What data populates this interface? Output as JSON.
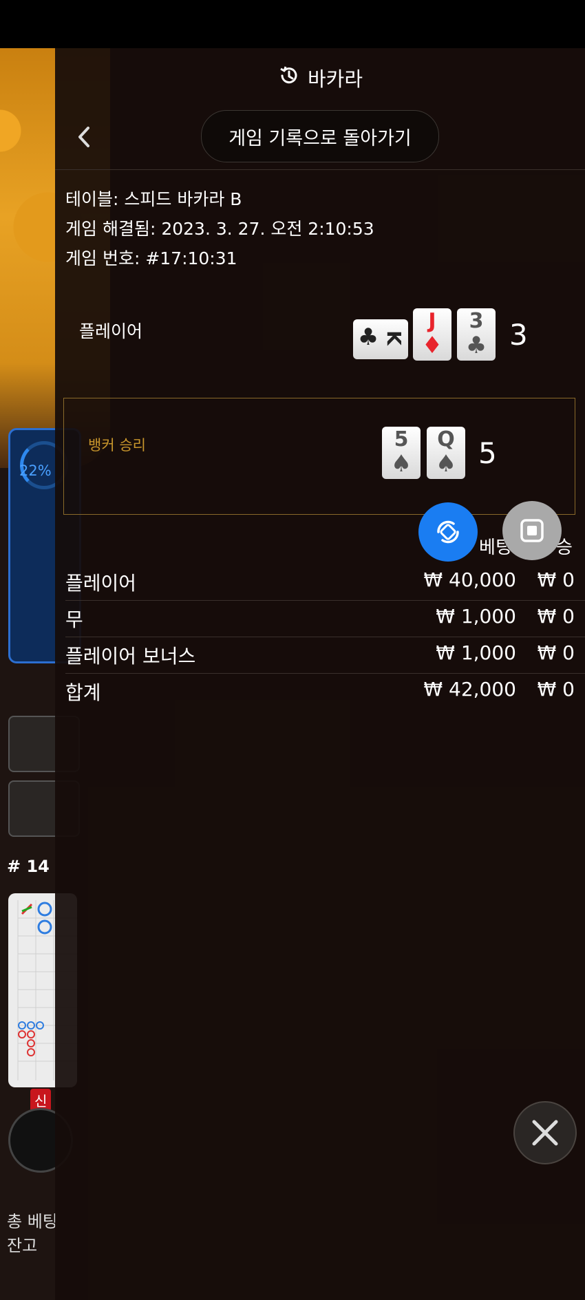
{
  "overlay": {
    "title": "바카라",
    "back_button_label": "게임 기록으로 돌아가기",
    "info": {
      "table": "테이블: 스피드 바카라 B",
      "resolved": "게임 해결됨: 2023. 3. 27. 오전 2:10:53",
      "game_number": "게임 번호: #17:10:31"
    },
    "player": {
      "label": "플레이어",
      "cards": [
        {
          "rank": "K",
          "suit": "♣",
          "color": "black",
          "sideways": true
        },
        {
          "rank": "J",
          "suit": "♦",
          "color": "red"
        },
        {
          "rank": "3",
          "suit": "♣",
          "color": "black"
        }
      ],
      "score": "3"
    },
    "banker": {
      "label": "뱅커 승리",
      "cards": [
        {
          "rank": "5",
          "suit": "♠",
          "color": "black"
        },
        {
          "rank": "Q",
          "suit": "♠",
          "color": "black"
        }
      ],
      "score": "5"
    },
    "bets_header": "베팅",
    "bets_header_end": "승",
    "bets": [
      {
        "label": "플레이어",
        "bet": "₩ 40,000",
        "win": "₩ 0"
      },
      {
        "label": "무",
        "bet": "₩ 1,000",
        "win": "₩ 0"
      },
      {
        "label": "플레이어 보너스",
        "bet": "₩ 1,000",
        "win": "₩ 0"
      }
    ],
    "total": {
      "label": "합계",
      "bet": "₩ 42,000",
      "win": "₩ 0"
    }
  },
  "background": {
    "percent": "22%",
    "round": "# 14",
    "new_badge": "신",
    "total_bet_label": "총 베팅",
    "balance_label": "잔고"
  },
  "colors": {
    "panel_bg": "#160c0a",
    "banker_accent": "#c8962c",
    "fab_blue": "#1a7df2",
    "card_red": "#e8242c"
  }
}
